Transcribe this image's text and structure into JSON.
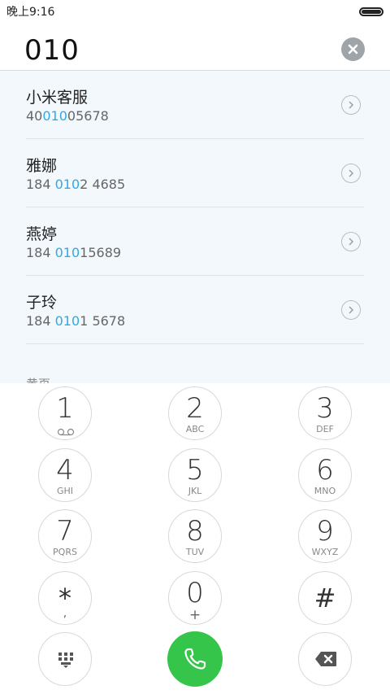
{
  "status_bar": {
    "time": "晚上9:16"
  },
  "dialer": {
    "number": "010"
  },
  "results": [
    {
      "name": "小米客服",
      "num_pre": "40",
      "num_hl": "010",
      "num_post": "05678"
    },
    {
      "name": "雅娜",
      "num_pre": "184 ",
      "num_hl": "010",
      "num_post": "2 4685"
    },
    {
      "name": "燕婷",
      "num_pre": "184 ",
      "num_hl": "010",
      "num_post": "15689"
    },
    {
      "name": "子玲",
      "num_pre": "184 ",
      "num_hl": "010",
      "num_post": "1 5678"
    }
  ],
  "section_peek": "黄页",
  "keypad": {
    "k1": {
      "digit": "1",
      "letters": ""
    },
    "k2": {
      "digit": "2",
      "letters": "ABC"
    },
    "k3": {
      "digit": "3",
      "letters": "DEF"
    },
    "k4": {
      "digit": "4",
      "letters": "GHI"
    },
    "k5": {
      "digit": "5",
      "letters": "JKL"
    },
    "k6": {
      "digit": "6",
      "letters": "MNO"
    },
    "k7": {
      "digit": "7",
      "letters": "PQRS"
    },
    "k8": {
      "digit": "8",
      "letters": "TUV"
    },
    "k9": {
      "digit": "9",
      "letters": "WXYZ"
    },
    "kstar": {
      "digit": "*",
      "letters": ","
    },
    "k0": {
      "digit": "0",
      "letters": "+"
    },
    "khash": {
      "digit": "#",
      "letters": ""
    }
  },
  "icons": {
    "voicemail": "voicemail-icon",
    "collapse": "dialpad-icon",
    "call": "phone-icon",
    "delete": "backspace-icon"
  },
  "colors": {
    "highlight": "#2fa9e8",
    "call": "#34c54a"
  }
}
